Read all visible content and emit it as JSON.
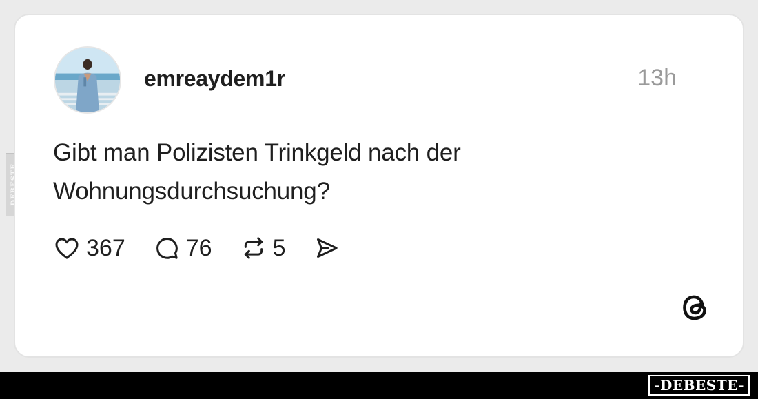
{
  "post": {
    "username": "emreaydem1r",
    "time": "13h",
    "text_line1": "Gibt man Polizisten Trinkgeld nach der",
    "text_line2": "Wohnungsdurchsuchung?",
    "likes": "367",
    "comments": "76",
    "reposts": "5"
  },
  "watermark": {
    "side": "DEBESTE",
    "brand": "-DEBESTE-"
  },
  "icons": {
    "like": "heart-icon",
    "comment": "comment-bubble-icon",
    "repost": "repost-icon",
    "share": "send-icon",
    "app": "threads-logo-icon"
  },
  "colors": {
    "text": "#1f1f1f",
    "muted": "#9a9a9a",
    "card_border": "#e3e3e3",
    "footer_bar": "#000000"
  }
}
